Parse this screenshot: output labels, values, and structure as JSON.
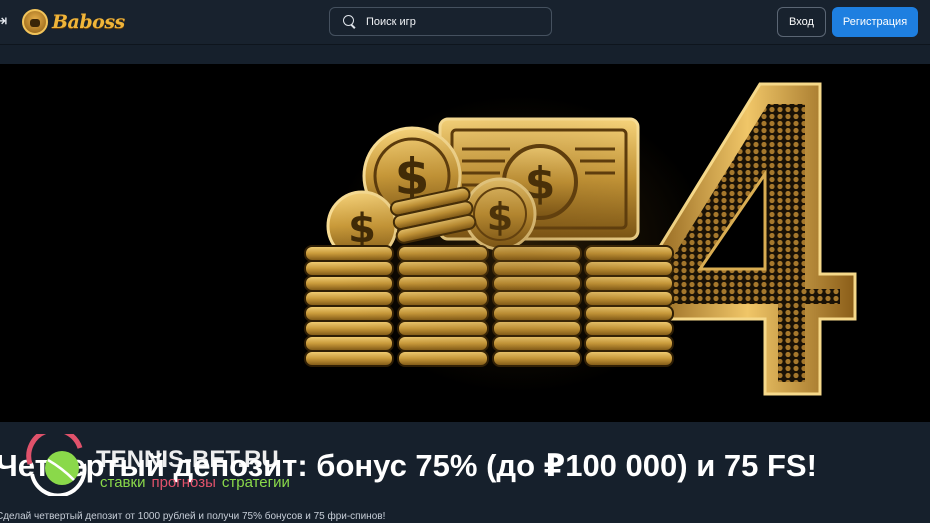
{
  "header": {
    "logo_text": "Baboss",
    "search_placeholder": "Поиск игр",
    "login_label": "Вход",
    "register_label": "Регистрация"
  },
  "banner": {
    "image": "gold-coins-and-banknote-with-number-4",
    "accent_color": "#c99a3a"
  },
  "promo": {
    "title": "Четвертый депозит: бонус 75% (до ₽100 000) и 75 FS!",
    "description": "Сделай четвертый депозит от 1000 рублей и получи 75% бонусов и 75 фри-спинов!"
  },
  "watermark": {
    "name": "TENNIS-BET.RU",
    "tag1": "ставки",
    "tag2": "прогнозы",
    "tag3": "стратегии"
  },
  "colors": {
    "header_bg": "#18222e",
    "page_bg": "#16202c",
    "register_button": "#1e7fe0"
  }
}
